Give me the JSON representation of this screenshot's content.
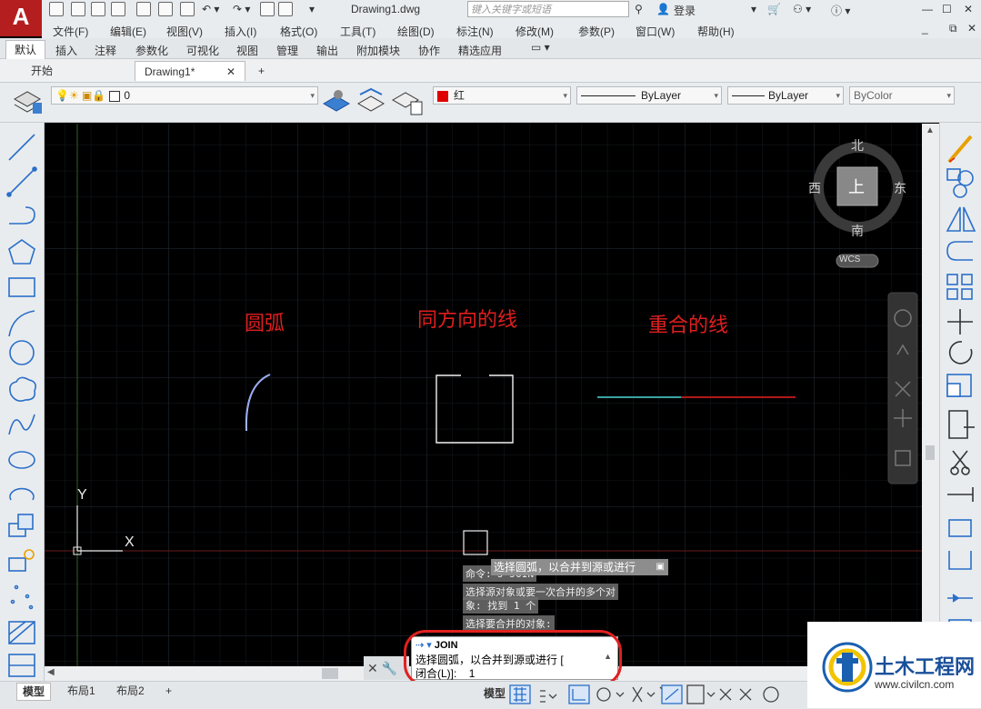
{
  "titlebar": {
    "doc_title": "Drawing1.dwg",
    "search_placeholder": "键入关键字或短语",
    "login": "登录"
  },
  "menubar": [
    "文件(F)",
    "编辑(E)",
    "视图(V)",
    "插入(I)",
    "格式(O)",
    "工具(T)",
    "绘图(D)",
    "标注(N)",
    "修改(M)",
    "参数(P)",
    "窗口(W)",
    "帮助(H)"
  ],
  "ribbon_tabs": [
    "默认",
    "插入",
    "注释",
    "参数化",
    "可视化",
    "视图",
    "管理",
    "输出",
    "附加模块",
    "协作",
    "精选应用"
  ],
  "file_tabs": {
    "start": "开始",
    "drawing": "Drawing1*"
  },
  "properties": {
    "layer": "0",
    "color": "红",
    "color_hex": "#e00000",
    "linetype": "ByLayer",
    "lineweight": "ByLayer",
    "plotstyle": "ByColor"
  },
  "viewcube": {
    "north": "北",
    "south": "南",
    "east": "东",
    "west": "西",
    "top": "上",
    "wcs": "WCS"
  },
  "ucs": {
    "x": "X",
    "y": "Y"
  },
  "canvas_labels": {
    "arc": "圆弧",
    "same_direction": "同方向的线",
    "overlap": "重合的线"
  },
  "command_history": {
    "line1": "命令: J JOIN",
    "line2": "选择源对象或要一次合并的多个对",
    "line3": "象: 找到 1 个",
    "line4": "选择要合并的对象:"
  },
  "tooltip": "选择圆弧，以合并到源或进行",
  "command_box": {
    "cmd": "JOIN",
    "prompt1": "选择圆弧，以合并到源或进行 [",
    "prompt2": "闭合(L)]:",
    "input": "1"
  },
  "status": {
    "model": "模型",
    "layout1": "布局1",
    "layout2": "布局2",
    "model_btn": "模型"
  },
  "watermark": {
    "name": "土木工程网",
    "url": "www.civilcn.com"
  }
}
